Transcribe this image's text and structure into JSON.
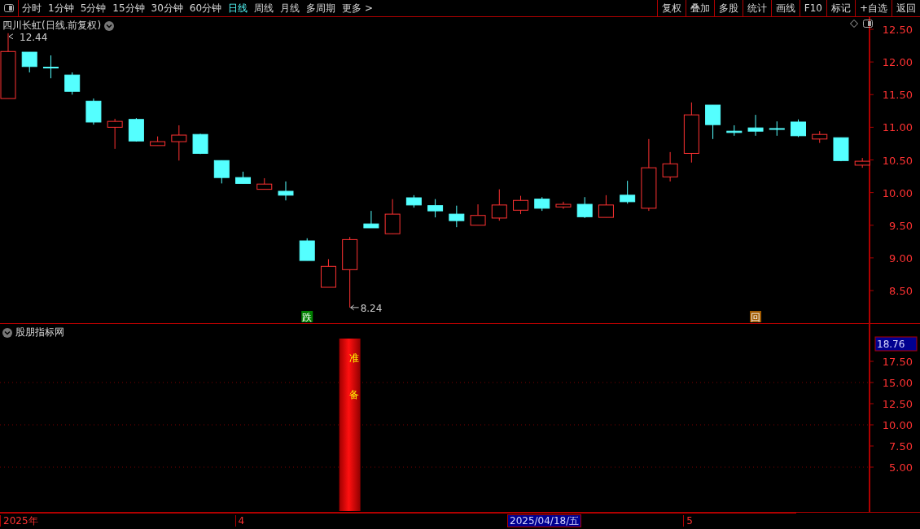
{
  "toolbar": {
    "periods": [
      {
        "label": "分时",
        "selected": false
      },
      {
        "label": "1分钟",
        "selected": false
      },
      {
        "label": "5分钟",
        "selected": false
      },
      {
        "label": "15分钟",
        "selected": false
      },
      {
        "label": "30分钟",
        "selected": false
      },
      {
        "label": "60分钟",
        "selected": false
      },
      {
        "label": "日线",
        "selected": true
      },
      {
        "label": "周线",
        "selected": false
      },
      {
        "label": "月线",
        "selected": false
      },
      {
        "label": "多周期",
        "selected": false
      },
      {
        "label": "更多 >",
        "selected": false
      }
    ],
    "buttons": [
      "复权",
      "叠加",
      "多股",
      "统计",
      "画线",
      "F10",
      "标记",
      "+自选",
      "返回"
    ]
  },
  "main_chart": {
    "title": "四川长虹(日线.前复权)",
    "price_axis": [
      "12.50",
      "12.00",
      "11.50",
      "11.00",
      "10.50",
      "10.00",
      "9.50",
      "9.00",
      "8.50"
    ],
    "high_label": "12.44",
    "low_label": "8.24",
    "signals": [
      {
        "kind": "fall",
        "label": "跌"
      },
      {
        "kind": "return",
        "label": "回"
      }
    ]
  },
  "indicator": {
    "title": "股朋指标网",
    "current": "18.76",
    "value_axis": [
      "17.50",
      "15.00",
      "12.50",
      "10.00",
      "7.50",
      "5.00"
    ],
    "bar_labels": [
      "准",
      "备"
    ]
  },
  "date_axis": {
    "labels": [
      "2025年",
      "4",
      "5"
    ],
    "cursor": "2025/04/18/五"
  }
}
